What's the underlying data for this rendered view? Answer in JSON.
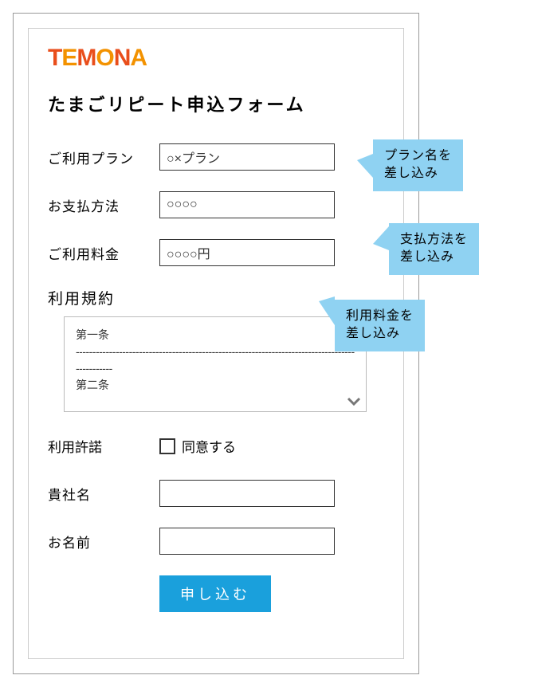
{
  "logo": {
    "t": "T",
    "e": "E",
    "m": "M",
    "o1": "O",
    "n": "N",
    "a": "A"
  },
  "form_title": "たまごリピート申込フォーム",
  "fields": {
    "plan": {
      "label": "ご利用プラン",
      "value": "○×プラン"
    },
    "payment": {
      "label": "お支払方法",
      "value": "○○○○"
    },
    "fee": {
      "label": "ご利用料金",
      "value": "○○○○円"
    },
    "license": {
      "label": "利用許諾",
      "checkbox_text": "同意する"
    },
    "company": {
      "label": "貴社名",
      "value": ""
    },
    "name": {
      "label": "お名前",
      "value": ""
    }
  },
  "terms": {
    "label": "利用規約",
    "c1": "第一条",
    "c2": "第二条",
    "dashes": "-----------------------------------------------------------------------------------------------"
  },
  "submit_label": "申し込む",
  "callouts": {
    "c1_l1": "プラン名を",
    "c1_l2": "差し込み",
    "c2_l1": "支払方法を",
    "c2_l2": "差し込み",
    "c3_l1": "利用料金を",
    "c3_l2": "差し込み"
  }
}
